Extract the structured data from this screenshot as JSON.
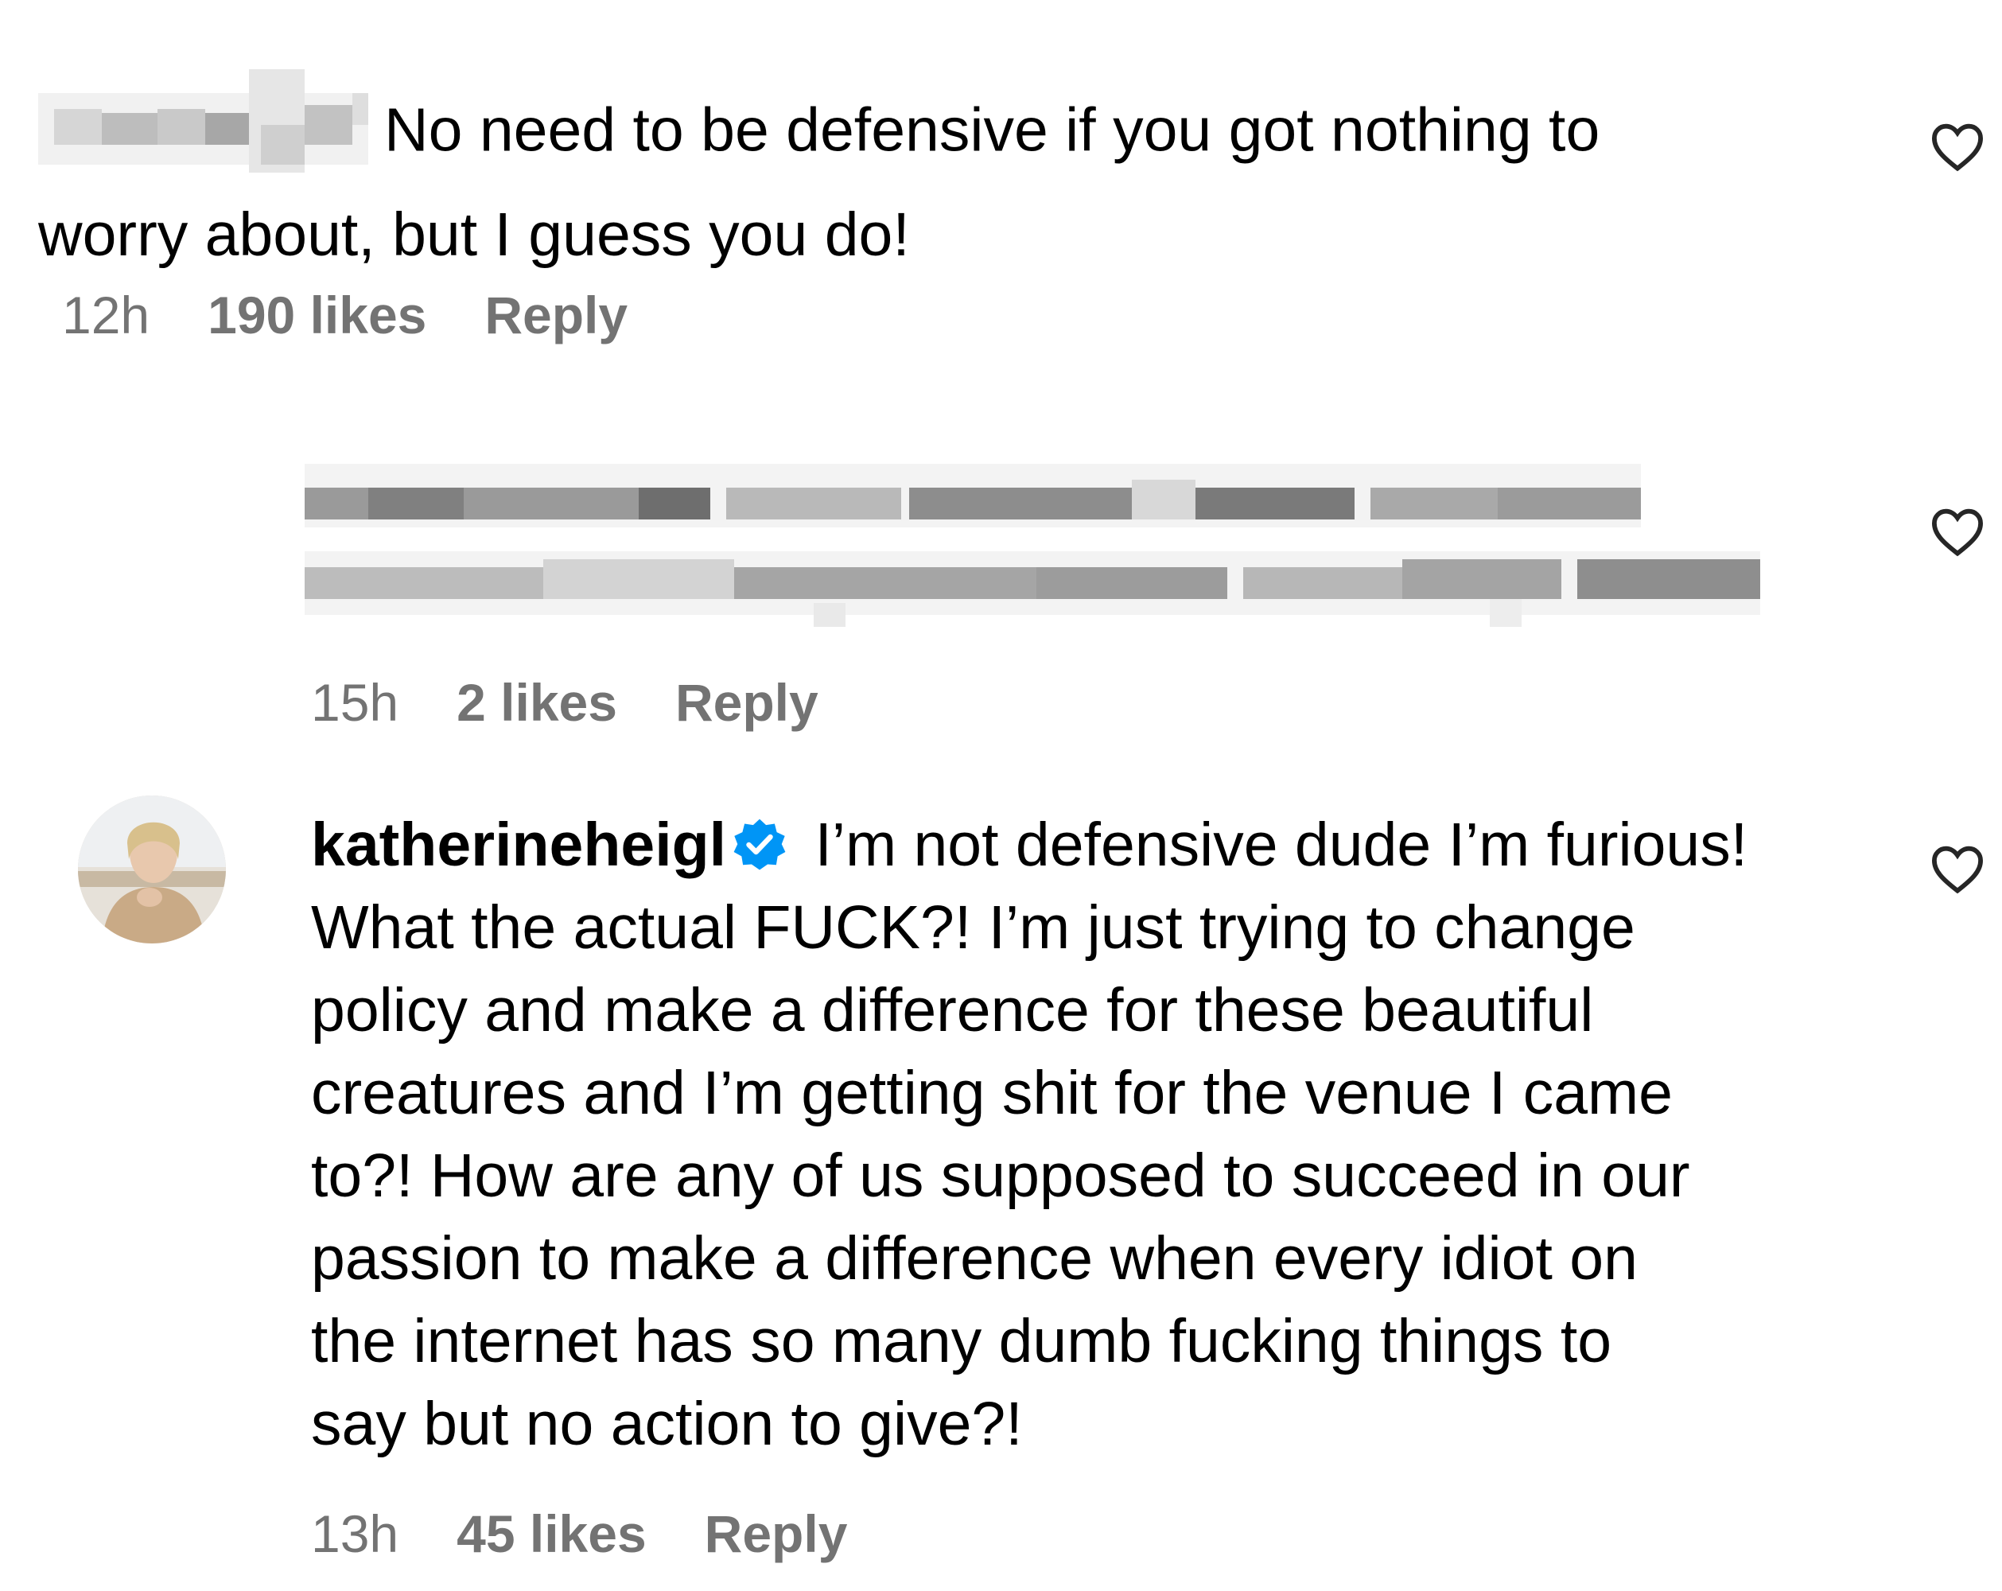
{
  "comments": [
    {
      "username_redacted": true,
      "text": "No need to be defensive if you got nothing to worry about, but I guess you do!",
      "line1": "No need to be defensive if you got nothing to",
      "line2": "worry about, but I guess you do!",
      "time": "12h",
      "likes": "190 likes",
      "reply": "Reply",
      "like_icon": "heart-outline-icon"
    },
    {
      "username_redacted": true,
      "text_redacted": true,
      "time": "15h",
      "likes": "2 likes",
      "reply": "Reply",
      "like_icon": "heart-outline-icon"
    },
    {
      "username": "katherineheigl",
      "verified": true,
      "verified_icon": "verified-badge-icon",
      "text": "I’m not defensive dude I’m furious! What the actual FUCK?! I’m just trying to change policy and make a difference for these beautiful creatures and I’m getting shit for the venue I came to?! How are any of us supposed to succeed in our passion to make a difference when every idiot on the internet has so many dumb fucking things to say but no action to give?!",
      "lines": [
        " I’m not defensive dude I’m furious!",
        "What the actual FUCK?! I’m just trying to change",
        "policy and make a difference for these beautiful",
        "creatures and I’m getting shit for the venue I came",
        "to?! How are any of us supposed to succeed in our",
        "passion to make a difference when every idiot on",
        "the internet has so many dumb fucking things to",
        "say but no action to give?!"
      ],
      "time": "13h",
      "likes": "45 likes",
      "reply": "Reply",
      "like_icon": "heart-outline-icon"
    }
  ],
  "colors": {
    "text": "#000000",
    "meta": "#737373",
    "verified": "#0095f6",
    "background": "#ffffff"
  }
}
